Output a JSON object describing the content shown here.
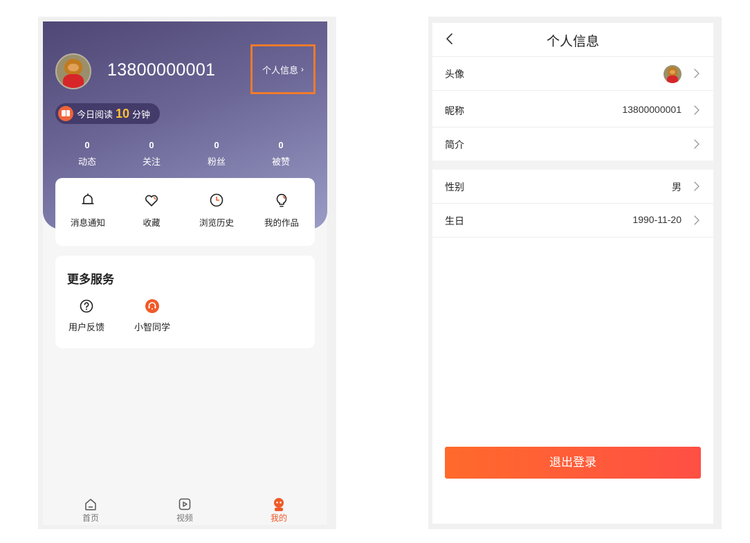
{
  "left": {
    "username": "13800000001",
    "profile_link": "个人信息",
    "reading": {
      "prefix": "今日阅读",
      "minutes": "10",
      "unit": "分钟"
    },
    "stats": [
      {
        "value": "0",
        "label": "动态"
      },
      {
        "value": "0",
        "label": "关注"
      },
      {
        "value": "0",
        "label": "粉丝"
      },
      {
        "value": "0",
        "label": "被赞"
      }
    ],
    "menu": [
      {
        "label": "消息通知",
        "icon": "bell-icon"
      },
      {
        "label": "收藏",
        "icon": "heart-icon"
      },
      {
        "label": "浏览历史",
        "icon": "clock-icon"
      },
      {
        "label": "我的作品",
        "icon": "bulb-icon"
      }
    ],
    "services": {
      "title": "更多服务",
      "items": [
        {
          "label": "用户反馈",
          "icon": "question-icon"
        },
        {
          "label": "小智同学",
          "icon": "robot-icon"
        }
      ]
    },
    "tabs": [
      {
        "label": "首页",
        "icon": "home-icon"
      },
      {
        "label": "视频",
        "icon": "video-icon"
      },
      {
        "label": "我的",
        "icon": "mine-icon",
        "active": true
      }
    ]
  },
  "right": {
    "title": "个人信息",
    "rows": [
      {
        "label": "头像",
        "value": ""
      },
      {
        "label": "昵称",
        "value": "13800000001"
      },
      {
        "label": "简介",
        "value": ""
      },
      {
        "label": "性别",
        "value": "男"
      },
      {
        "label": "生日",
        "value": "1990-11-20"
      }
    ],
    "logout": "退出登录"
  },
  "colors": {
    "accent": "#f05a28",
    "header_gradient_start": "#4f4775",
    "header_gradient_end": "#9a9cc6",
    "highlight_box": "#f07a2c",
    "reading_minutes": "#ffc23a"
  }
}
